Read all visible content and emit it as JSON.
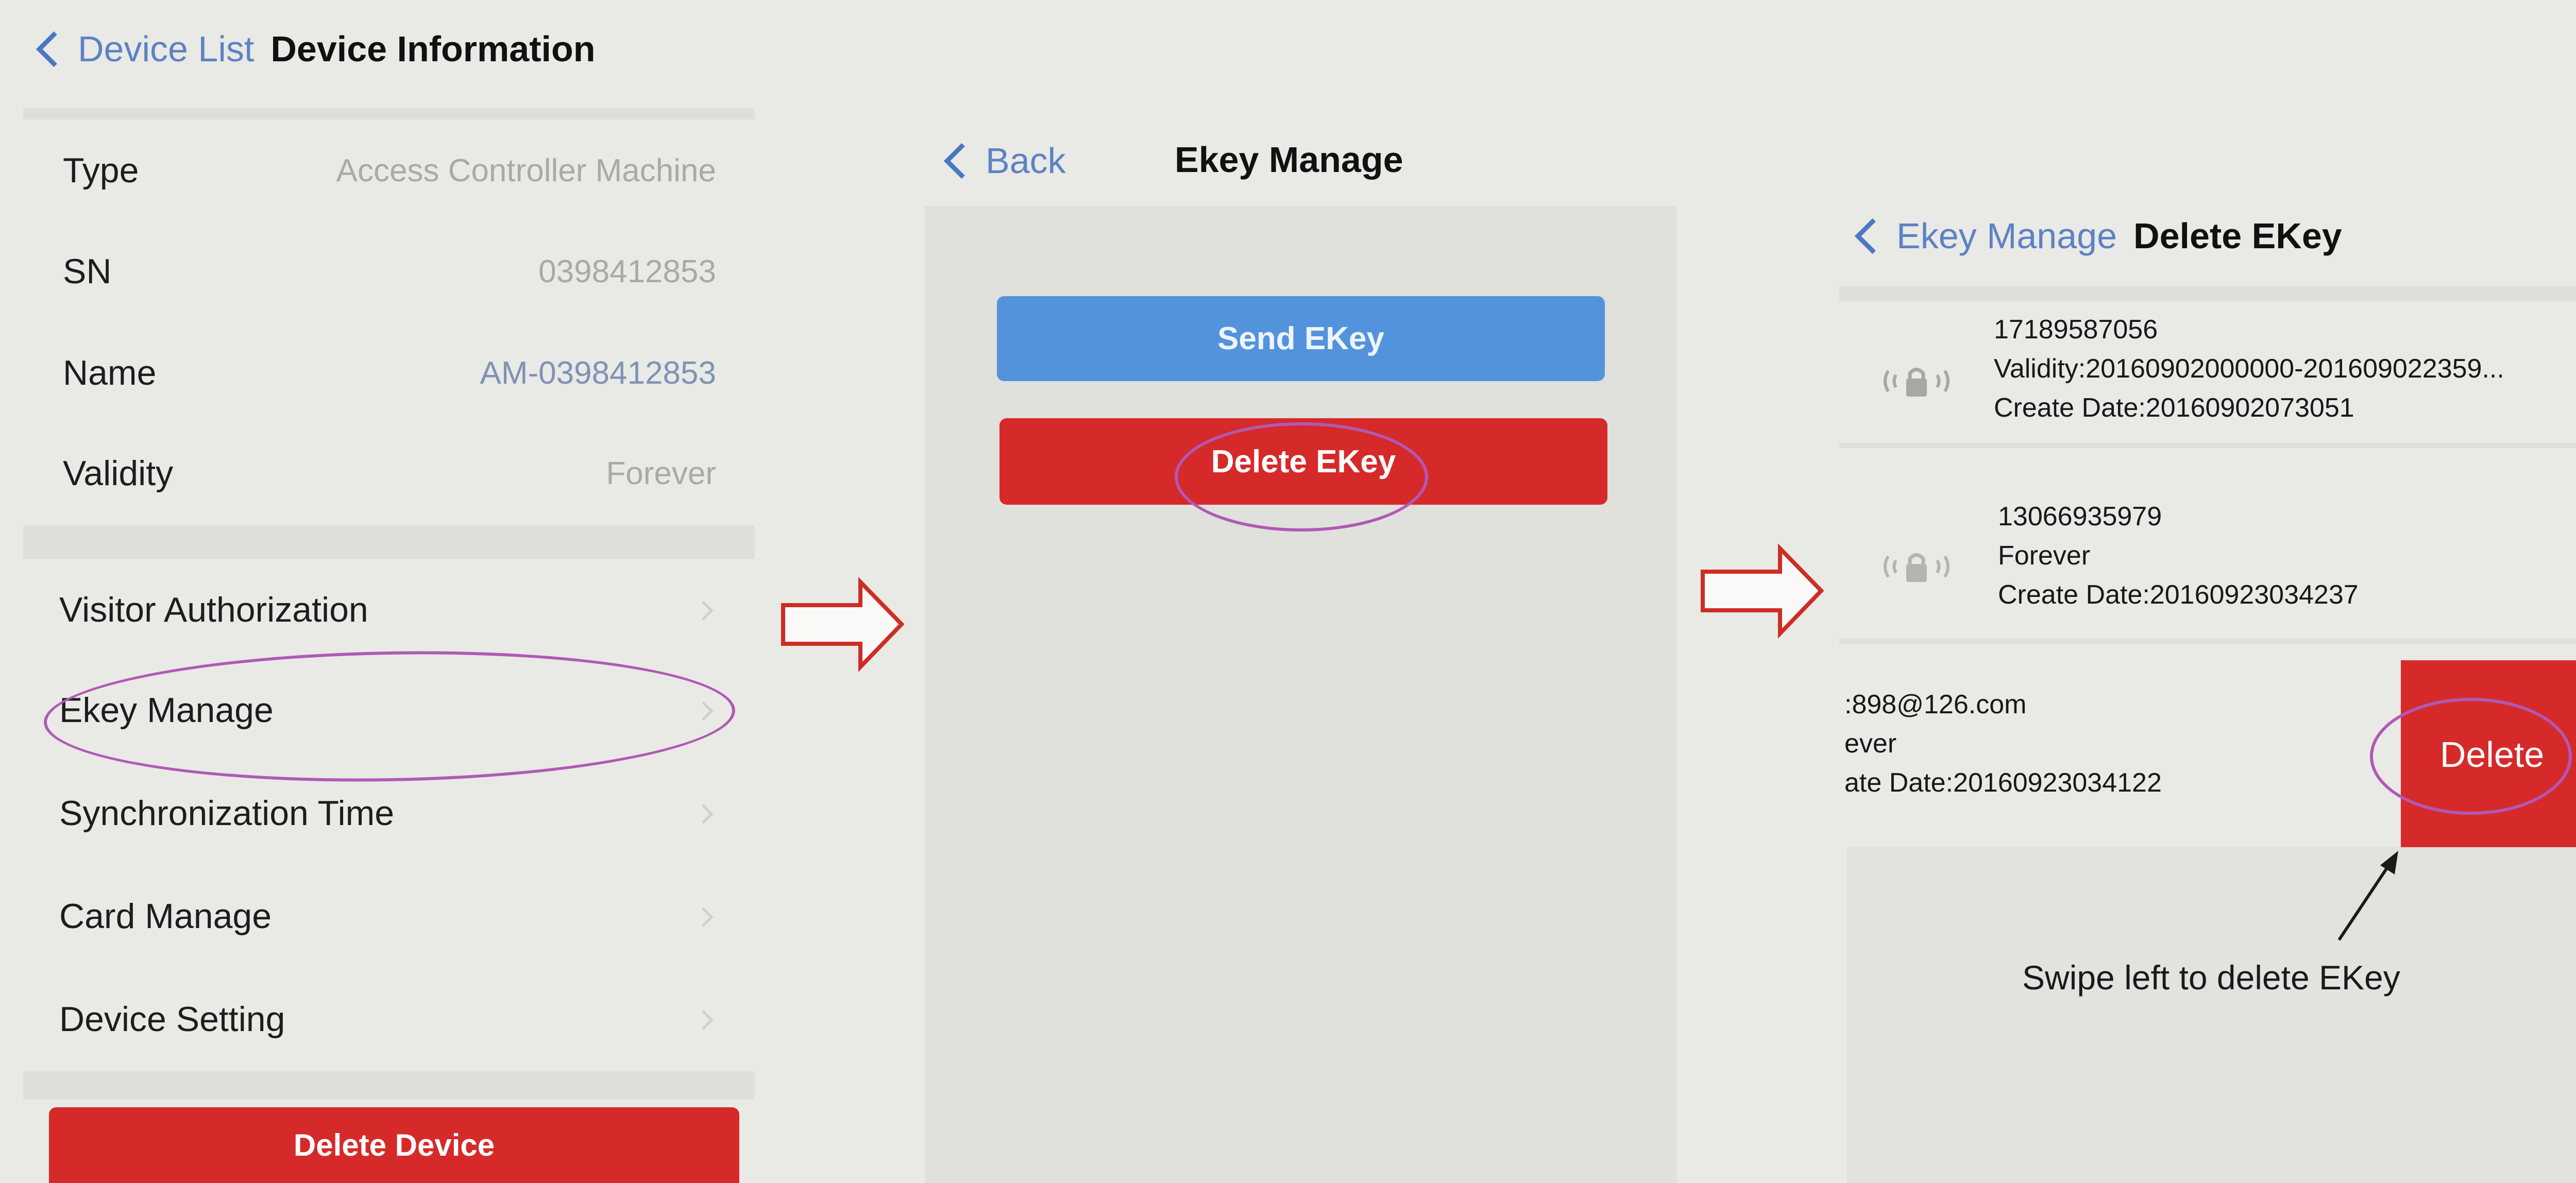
{
  "panel1": {
    "nav": {
      "back_label": "Device List",
      "title": "Device Information"
    },
    "info_rows": [
      {
        "label": "Type",
        "value": "Access Controller Machine",
        "value_color": "#a9a9a6"
      },
      {
        "label": "SN",
        "value": "0398412853",
        "value_color": "#a9a9a6"
      },
      {
        "label": "Name",
        "value": "AM-0398412853",
        "value_color": "#7f93b3"
      },
      {
        "label": "Validity",
        "value": "Forever",
        "value_color": "#a9a9a6"
      }
    ],
    "menu_items": [
      {
        "label": "Visitor Authorization"
      },
      {
        "label": "Ekey Manage"
      },
      {
        "label": "Synchronization Time"
      },
      {
        "label": "Card Manage"
      },
      {
        "label": "Device Setting"
      }
    ],
    "delete_button": "Delete Device"
  },
  "panel2": {
    "nav": {
      "back_label": "Back",
      "title": "Ekey Manage"
    },
    "send_button": "Send EKey",
    "delete_button": "Delete EKey"
  },
  "panel3": {
    "nav": {
      "back_label": "Ekey Manage",
      "title": "Delete EKey"
    },
    "ekeys": [
      {
        "account": "17189587056",
        "validity": "Validity:20160902000000-201609022359...",
        "created": "Create Date:20160902073051"
      },
      {
        "account": "13066935979",
        "validity": "Forever",
        "created": "Create Date:20160923034237"
      },
      {
        "account": ":898@126.com",
        "validity": "ever",
        "created": "ate Date:20160923034122"
      }
    ],
    "swipe_delete_button": "Delete",
    "annotation": "Swipe left to delete EKey"
  },
  "colors": {
    "accent_blue": "#5393dc",
    "danger_red": "#d62a2a",
    "highlight_ellipse": "#b059b5",
    "flow_arrow": "#cc2d24"
  },
  "icons": [
    "chevron-left-icon",
    "chevron-right-icon",
    "lock-icon",
    "flow-arrow-icon",
    "pointer-arrow-icon"
  ]
}
